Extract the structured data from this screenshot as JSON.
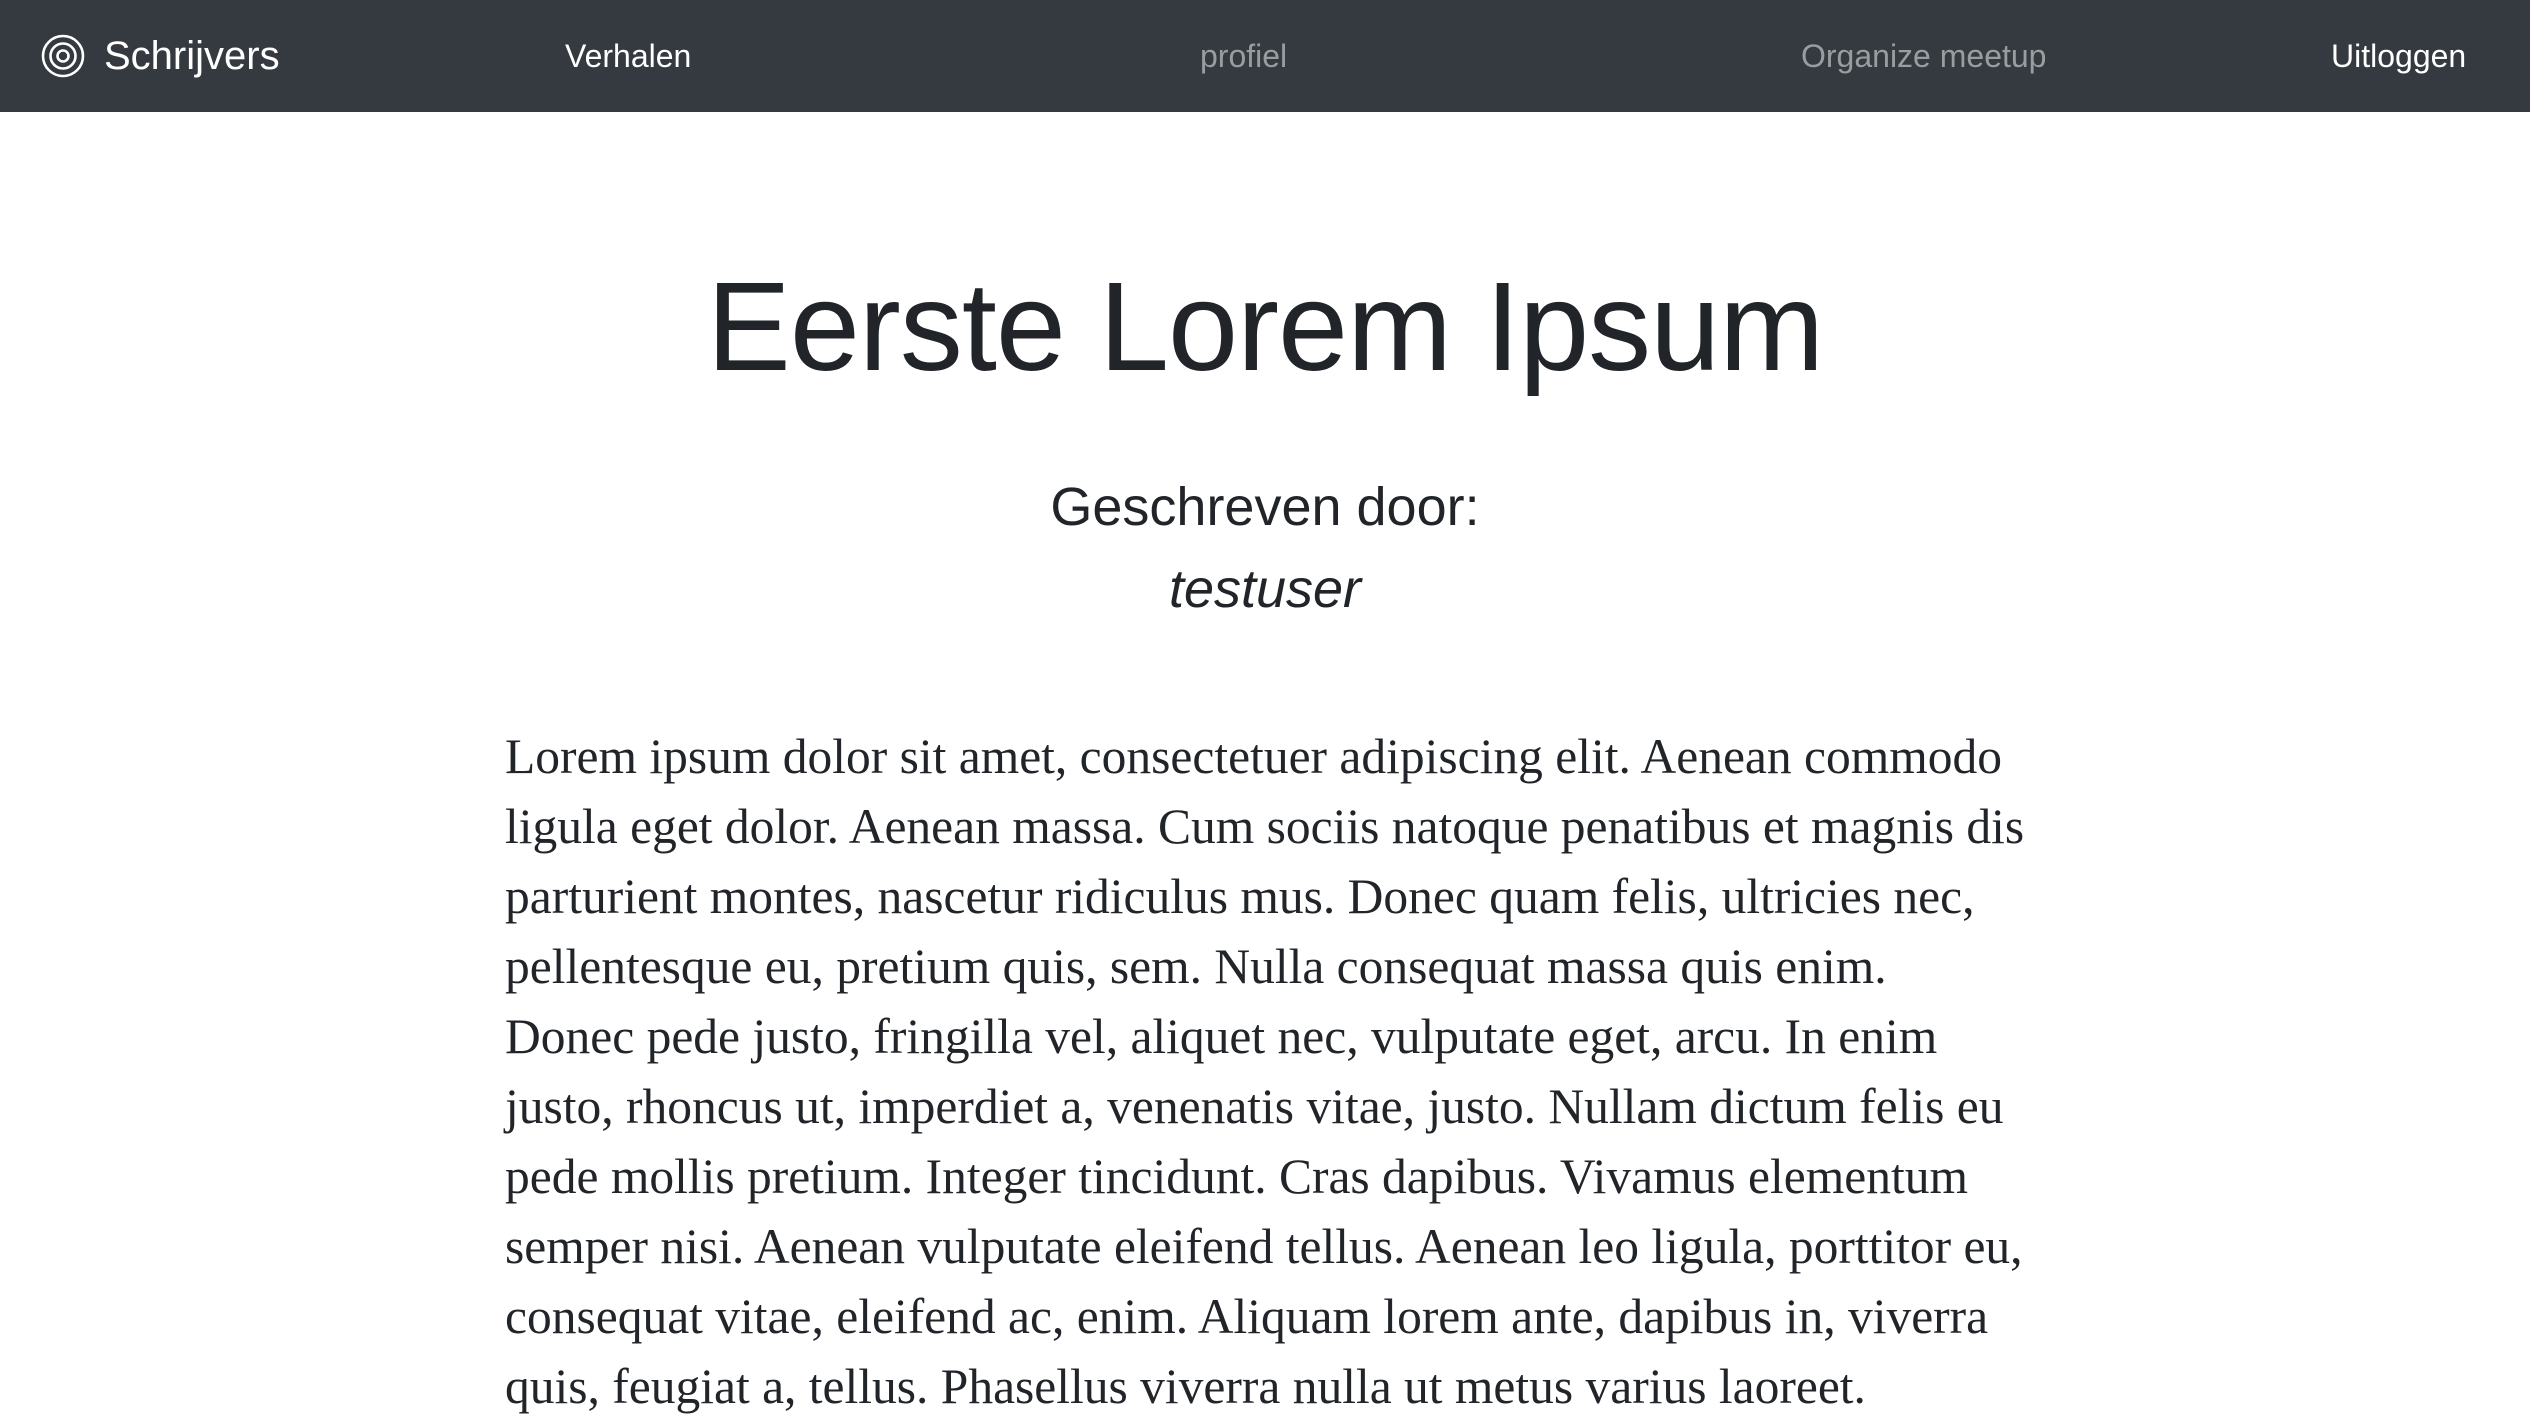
{
  "navbar": {
    "brand": {
      "icon": "concentric-circles-icon",
      "label": "Schrijvers"
    },
    "links": {
      "stories": "Verhalen",
      "profile": "profiel",
      "organize_meetup": "Organize meetup",
      "logout": "Uitloggen"
    },
    "colors": {
      "background": "#343a40",
      "active_link": "#ffffff",
      "muted_link": "#9a9da0"
    }
  },
  "story": {
    "title": "Eerste Lorem Ipsum",
    "written_by_label": "Geschreven door:",
    "author": "testuser",
    "body": "Lorem ipsum dolor sit amet, consectetuer adipiscing elit. Aenean commodo ligula eget dolor. Aenean massa. Cum sociis natoque penatibus et magnis dis parturient montes, nascetur ridiculus mus. Donec quam felis, ultricies nec, pellentesque eu, pretium quis, sem. Nulla consequat massa quis enim. Donec pede justo, fringilla vel, aliquet nec, vulputate eget, arcu. In enim justo, rhoncus ut, imperdiet a, venenatis vitae, justo. Nullam dictum felis eu pede mollis pretium. Integer tincidunt. Cras dapibus. Vivamus elementum semper nisi. Aenean vulputate eleifend tellus. Aenean leo ligula, porttitor eu, consequat vitae, eleifend ac, enim. Aliquam lorem ante, dapibus in, viverra quis, feugiat a, tellus. Phasellus viverra nulla ut metus varius laoreet."
  }
}
